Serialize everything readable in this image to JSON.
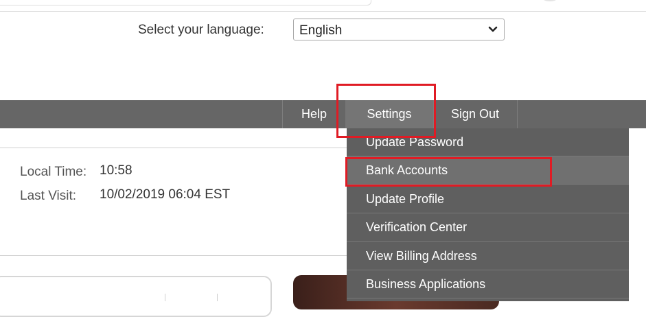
{
  "language": {
    "label": "Select your language:",
    "selected": "English",
    "icon": "chevron-down-icon"
  },
  "nav": {
    "help": "Help",
    "settings": "Settings",
    "sign_out": "Sign Out"
  },
  "settings_menu": {
    "items": [
      {
        "label": "Update Password"
      },
      {
        "label": "Bank Accounts",
        "state": "hovered"
      },
      {
        "label": "Update Profile"
      },
      {
        "label": "Verification Center"
      },
      {
        "label": "View Billing Address"
      },
      {
        "label": "Business Applications"
      }
    ]
  },
  "session": {
    "local_time_label": "Local Time:",
    "local_time_value": "10:58",
    "last_visit_label": "Last Visit:",
    "last_visit_value": "10/02/2019 06:04 EST"
  },
  "colors": {
    "nav_bg": "#666666",
    "menu_bg": "#5f5f5f",
    "highlight": "#e01b24"
  }
}
